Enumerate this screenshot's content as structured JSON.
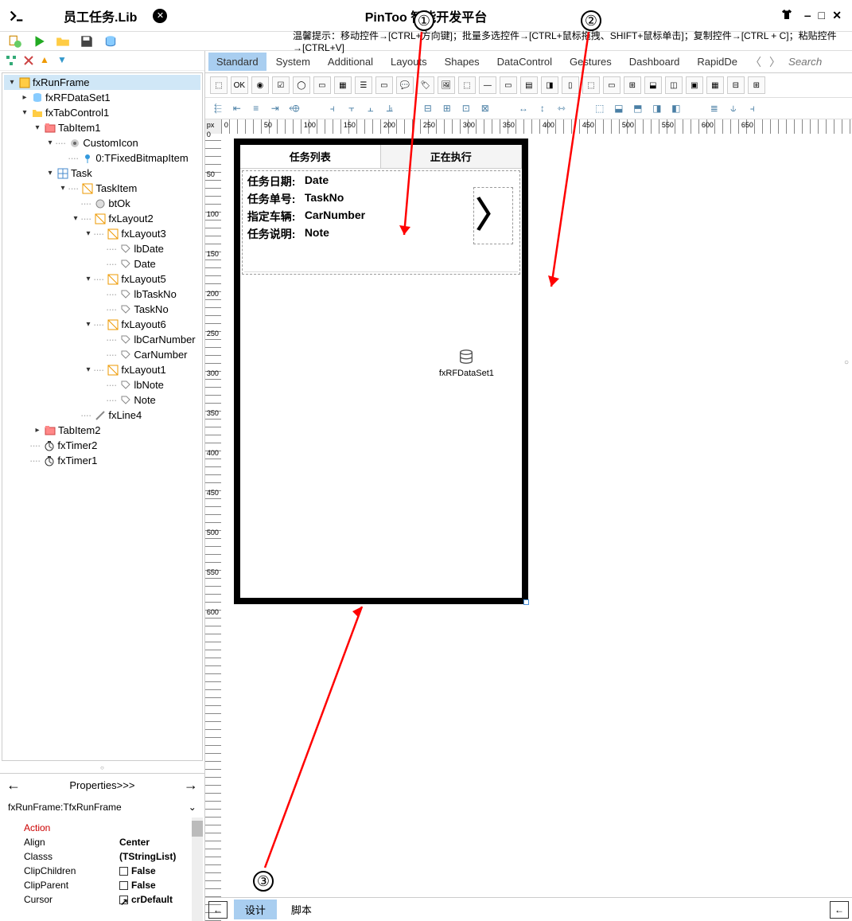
{
  "title_bar": {
    "doc_title": "员工任务.Lib",
    "app_title": "PinToo 智能开发平台"
  },
  "hint": "温馨提示：移动控件→[CTRL+方向键]；批量多选控件→[CTRL+鼠标拖拽、SHIFT+鼠标单击]；复制控件→[CTRL + C]；粘贴控件→[CTRL+V]",
  "tree": [
    {
      "d": 0,
      "exp": "▾",
      "icon": "frame",
      "label": "fxRunFrame",
      "sel": true
    },
    {
      "d": 1,
      "exp": "▸",
      "icon": "db",
      "label": "fxRFDataSet1"
    },
    {
      "d": 1,
      "exp": "▾",
      "icon": "folder",
      "label": "fxTabControl1"
    },
    {
      "d": 2,
      "exp": "▾",
      "icon": "tab",
      "label": "TabItem1"
    },
    {
      "d": 3,
      "exp": "▾",
      "icon": "gear",
      "label": "CustomIcon",
      "dots": true
    },
    {
      "d": 4,
      "exp": "",
      "icon": "pin",
      "label": "0:TFixedBitmapItem",
      "dots": true
    },
    {
      "d": 3,
      "exp": "▾",
      "icon": "grid",
      "label": "Task"
    },
    {
      "d": 4,
      "exp": "▾",
      "icon": "layout",
      "label": "TaskItem",
      "dots": true
    },
    {
      "d": 5,
      "exp": "",
      "icon": "btn",
      "label": "btOk",
      "dots": true
    },
    {
      "d": 5,
      "exp": "▾",
      "icon": "layout",
      "label": "fxLayout2",
      "dots": true
    },
    {
      "d": 6,
      "exp": "▾",
      "icon": "layout",
      "label": "fxLayout3",
      "dots": true
    },
    {
      "d": 7,
      "exp": "",
      "icon": "tag",
      "label": "lbDate",
      "dots": true
    },
    {
      "d": 7,
      "exp": "",
      "icon": "tag",
      "label": "Date",
      "dots": true
    },
    {
      "d": 6,
      "exp": "▾",
      "icon": "layout",
      "label": "fxLayout5",
      "dots": true
    },
    {
      "d": 7,
      "exp": "",
      "icon": "tag",
      "label": "lbTaskNo",
      "dots": true
    },
    {
      "d": 7,
      "exp": "",
      "icon": "tag",
      "label": "TaskNo",
      "dots": true
    },
    {
      "d": 6,
      "exp": "▾",
      "icon": "layout",
      "label": "fxLayout6",
      "dots": true
    },
    {
      "d": 7,
      "exp": "",
      "icon": "tag",
      "label": "lbCarNumber",
      "dots": true
    },
    {
      "d": 7,
      "exp": "",
      "icon": "tag",
      "label": "CarNumber",
      "dots": true
    },
    {
      "d": 6,
      "exp": "▾",
      "icon": "layout",
      "label": "fxLayout1",
      "dots": true
    },
    {
      "d": 7,
      "exp": "",
      "icon": "tag",
      "label": "lbNote",
      "dots": true
    },
    {
      "d": 7,
      "exp": "",
      "icon": "tag",
      "label": "Note",
      "dots": true
    },
    {
      "d": 5,
      "exp": "",
      "icon": "line",
      "label": "fxLine4",
      "dots": true
    },
    {
      "d": 2,
      "exp": "▸",
      "icon": "tab",
      "label": "TabItem2"
    },
    {
      "d": 1,
      "exp": "",
      "icon": "timer",
      "label": "fxTimer2",
      "dots": true
    },
    {
      "d": 1,
      "exp": "",
      "icon": "timer",
      "label": "fxTimer1",
      "dots": true
    }
  ],
  "props_nav": "Properties>>>",
  "obj_label": "fxRunFrame:TfxRunFrame",
  "props": [
    {
      "name": "Action",
      "val": "",
      "cls": "action"
    },
    {
      "name": "Align",
      "val": "Center"
    },
    {
      "name": "Classs",
      "val": "(TStringList)"
    },
    {
      "name": "ClipChildren",
      "val": "False",
      "check": true
    },
    {
      "name": "ClipParent",
      "val": "False",
      "check": true
    },
    {
      "name": "Cursor",
      "val": "crDefault",
      "icon": true
    }
  ],
  "comp_tabs": [
    "Standard",
    "System",
    "Additional",
    "Layouts",
    "Shapes",
    "DataControl",
    "Gestures",
    "Dashboard",
    "RapidDe"
  ],
  "search_placeholder": "Search",
  "ruler_corner": "px",
  "h_ticks": [
    0,
    50,
    100,
    150,
    200,
    250,
    300,
    350,
    400,
    450,
    500,
    550,
    600,
    650
  ],
  "v_ticks": [
    0,
    50,
    100,
    150,
    200,
    250,
    300,
    350,
    400,
    450,
    500,
    550,
    600
  ],
  "phone": {
    "tab1": "任务列表",
    "tab2": "正在执行",
    "rows": [
      {
        "label": "任务日期:",
        "val": "Date"
      },
      {
        "label": "任务单号:",
        "val": "TaskNo"
      },
      {
        "label": "指定车辆:",
        "val": "CarNumber"
      },
      {
        "label": "任务说明:",
        "val": "Note"
      }
    ],
    "ds_label": "fxRFDataSet1"
  },
  "bottom_tabs": {
    "design": "设计",
    "script": "脚本"
  },
  "annotations": {
    "a1": "①",
    "a2": "②",
    "a3": "③"
  }
}
